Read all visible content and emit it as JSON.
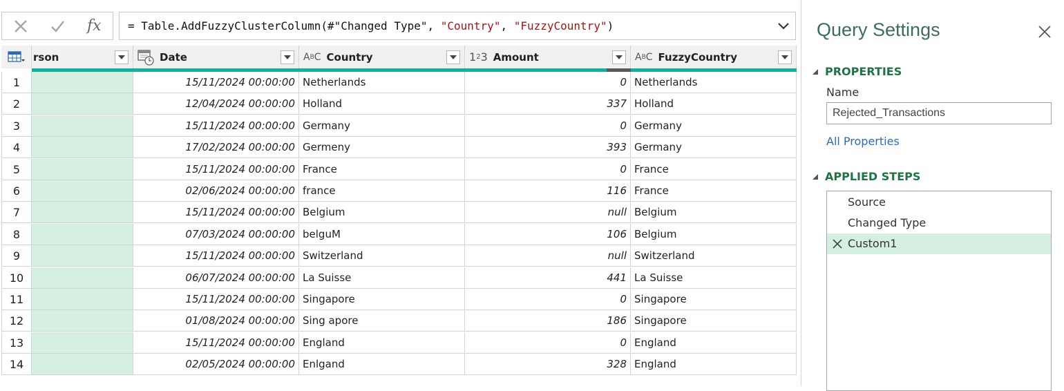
{
  "formula_bar": {
    "cancel_icon": "x-icon",
    "commit_icon": "check-icon",
    "fx_label": "fx",
    "formula_prefix": "= Table.AddFuzzyClusterColumn(#\"Changed Type\", ",
    "formula_arg1": "\"Country\"",
    "formula_sep": ", ",
    "formula_arg2": "\"FuzzyCountry\"",
    "formula_suffix": ")"
  },
  "columns": {
    "person": "rson",
    "date": "Date",
    "country": "Country",
    "amount": "Amount",
    "fuzzy": "FuzzyCountry",
    "type_text": "ABC",
    "type_number": "123"
  },
  "rows": [
    {
      "idx": "1",
      "date": "15/11/2024 00:00:00",
      "country": "Netherlands",
      "amount": "0",
      "fuzzy": "Netherlands"
    },
    {
      "idx": "2",
      "date": "12/04/2024 00:00:00",
      "country": "Holland",
      "amount": "337",
      "fuzzy": "Holland"
    },
    {
      "idx": "3",
      "date": "15/11/2024 00:00:00",
      "country": "Germany",
      "amount": "0",
      "fuzzy": "Germany"
    },
    {
      "idx": "4",
      "date": "17/02/2024 00:00:00",
      "country": "Germeny",
      "amount": "393",
      "fuzzy": "Germany"
    },
    {
      "idx": "5",
      "date": "15/11/2024 00:00:00",
      "country": "France",
      "amount": "0",
      "fuzzy": "France"
    },
    {
      "idx": "6",
      "date": "02/06/2024 00:00:00",
      "country": "france",
      "amount": "116",
      "fuzzy": "France"
    },
    {
      "idx": "7",
      "date": "15/11/2024 00:00:00",
      "country": "Belgium",
      "amount": "null",
      "fuzzy": "Belgium"
    },
    {
      "idx": "8",
      "date": "07/03/2024 00:00:00",
      "country": "belguM",
      "amount": "106",
      "fuzzy": "Belgium"
    },
    {
      "idx": "9",
      "date": "15/11/2024 00:00:00",
      "country": "Switzerland",
      "amount": "null",
      "fuzzy": "Switzerland"
    },
    {
      "idx": "10",
      "date": "06/07/2024 00:00:00",
      "country": "La Suisse",
      "amount": "441",
      "fuzzy": "La Suisse"
    },
    {
      "idx": "11",
      "date": "15/11/2024 00:00:00",
      "country": "Singapore",
      "amount": "0",
      "fuzzy": "Singapore"
    },
    {
      "idx": "12",
      "date": "01/08/2024 00:00:00",
      "country": "Sing apore",
      "amount": "186",
      "fuzzy": "Singapore"
    },
    {
      "idx": "13",
      "date": "15/11/2024 00:00:00",
      "country": "England",
      "amount": "0",
      "fuzzy": "England"
    },
    {
      "idx": "14",
      "date": "02/05/2024 00:00:00",
      "country": "Enlgand",
      "amount": "328",
      "fuzzy": "England"
    }
  ],
  "panel": {
    "title": "Query Settings",
    "properties_label": "PROPERTIES",
    "name_label": "Name",
    "name_value": "Rejected_Transactions",
    "all_properties": "All Properties",
    "applied_steps_label": "APPLIED STEPS",
    "steps": [
      "Source",
      "Changed Type",
      "Custom1"
    ],
    "selected_step": "Custom1"
  },
  "colors": {
    "quality_bar": "#13b19c",
    "selected_bg": "#d5efe2",
    "section_heading": "#217346",
    "link": "#2b6cb0"
  }
}
